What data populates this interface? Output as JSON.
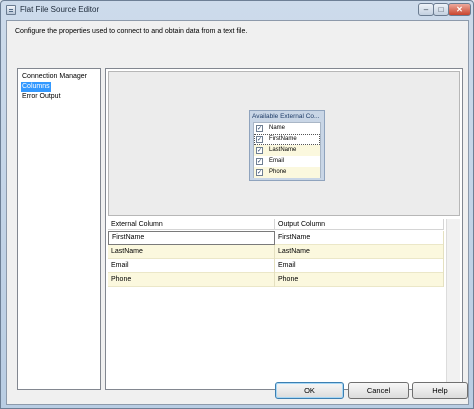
{
  "window": {
    "title": "Flat File Source Editor",
    "controls": {
      "minimize": "–",
      "maximize": "□",
      "close": "✕"
    }
  },
  "description": "Configure the properties used to connect to and obtain data from a text file.",
  "nav": {
    "items": [
      {
        "label": "Connection Manager"
      },
      {
        "label": "Columns",
        "selected": true
      },
      {
        "label": "Error Output"
      }
    ]
  },
  "external_columns_box": {
    "title": "Available External Co...",
    "rows": [
      {
        "label": "Name",
        "checked": true,
        "check_mark": "✓"
      },
      {
        "label": "FirstName",
        "checked": true,
        "check_mark": "✓"
      },
      {
        "label": "LastName",
        "checked": true,
        "check_mark": "✓"
      },
      {
        "label": "Email",
        "checked": true,
        "check_mark": "✓"
      },
      {
        "label": "Phone",
        "checked": true,
        "check_mark": "✓"
      }
    ]
  },
  "grid": {
    "headers": [
      "External Column",
      "Output Column"
    ],
    "rows": [
      {
        "external": "FirstName",
        "output": "FirstName"
      },
      {
        "external": "LastName",
        "output": "LastName"
      },
      {
        "external": "Email",
        "output": "Email"
      },
      {
        "external": "Phone",
        "output": "Phone"
      }
    ]
  },
  "buttons": {
    "ok": "OK",
    "cancel": "Cancel",
    "help": "Help"
  },
  "colors": {
    "selection": "#3399ff",
    "alt_row": "#fbf8de",
    "window_frame": "#b9cde3"
  }
}
